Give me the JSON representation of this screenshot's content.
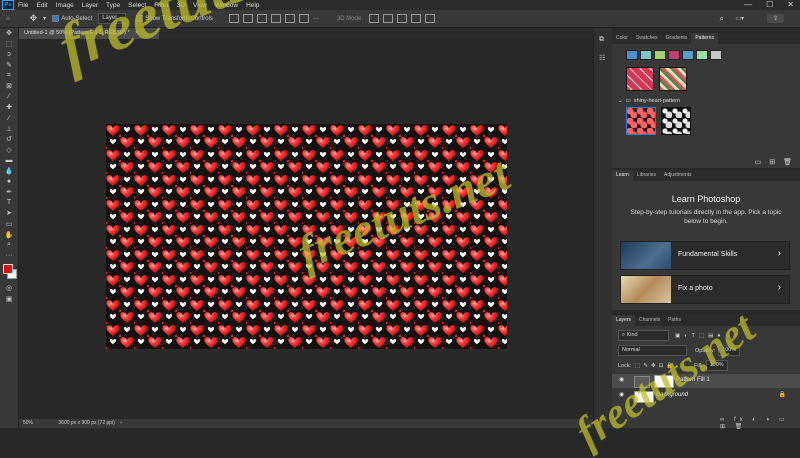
{
  "menu": {
    "logo": "Ps",
    "items": [
      "File",
      "Edit",
      "Image",
      "Layer",
      "Type",
      "Select",
      "Filter",
      "3D",
      "View",
      "Window",
      "Help"
    ]
  },
  "window_controls": [
    "—",
    "☐",
    "✕"
  ],
  "options": {
    "auto_select_label": "Auto-Select",
    "auto_select_target": "Layer",
    "show_transform_label": "Show Transform Controls",
    "mode_3d": "3D Mode:"
  },
  "document": {
    "tab_title": "Untitled-1 @ 50% (Pattern Fill 1, RGB/8#) *",
    "tab_close": "×"
  },
  "status": {
    "zoom": "50%",
    "doc_size": "3600 px x 900 px (72 ppi)"
  },
  "pattern_panel": {
    "tabs": [
      "Color",
      "Swatches",
      "Gradients",
      "Patterns"
    ],
    "active_tab": "Patterns",
    "group_name": "shiny-heart-pattern",
    "swatch_colors": [
      "#4d8fd1",
      "#7cc7c2",
      "#a6d36b",
      "#c13f6e",
      "#55a0c9",
      "#9edb9e",
      "#c8c8c8"
    ]
  },
  "learn_panel": {
    "tabs": [
      "Learn",
      "Libraries",
      "Adjustments"
    ],
    "title": "Learn Photoshop",
    "subtitle": "Step-by-step tutorials directly in the app. Pick a topic below to begin.",
    "topics": [
      {
        "label": "Fundamental Skills"
      },
      {
        "label": "Fix a photo"
      }
    ]
  },
  "layers_panel": {
    "tabs": [
      "Layers",
      "Channels",
      "Paths"
    ],
    "filter_kind": "Kind",
    "blend_mode": "Normal",
    "opacity_label": "Opacity:",
    "opacity_value": "100%",
    "lock_label": "Lock:",
    "fill_label": "Fill:",
    "fill_value": "100%",
    "layers": [
      {
        "name": "Pattern Fill 1"
      },
      {
        "name": "Background"
      }
    ]
  },
  "watermark": {
    "text": "freetuts.net"
  },
  "colors": {
    "foreground": "#e01010",
    "background": "#ffffff",
    "accent": "#2a7bdc"
  }
}
